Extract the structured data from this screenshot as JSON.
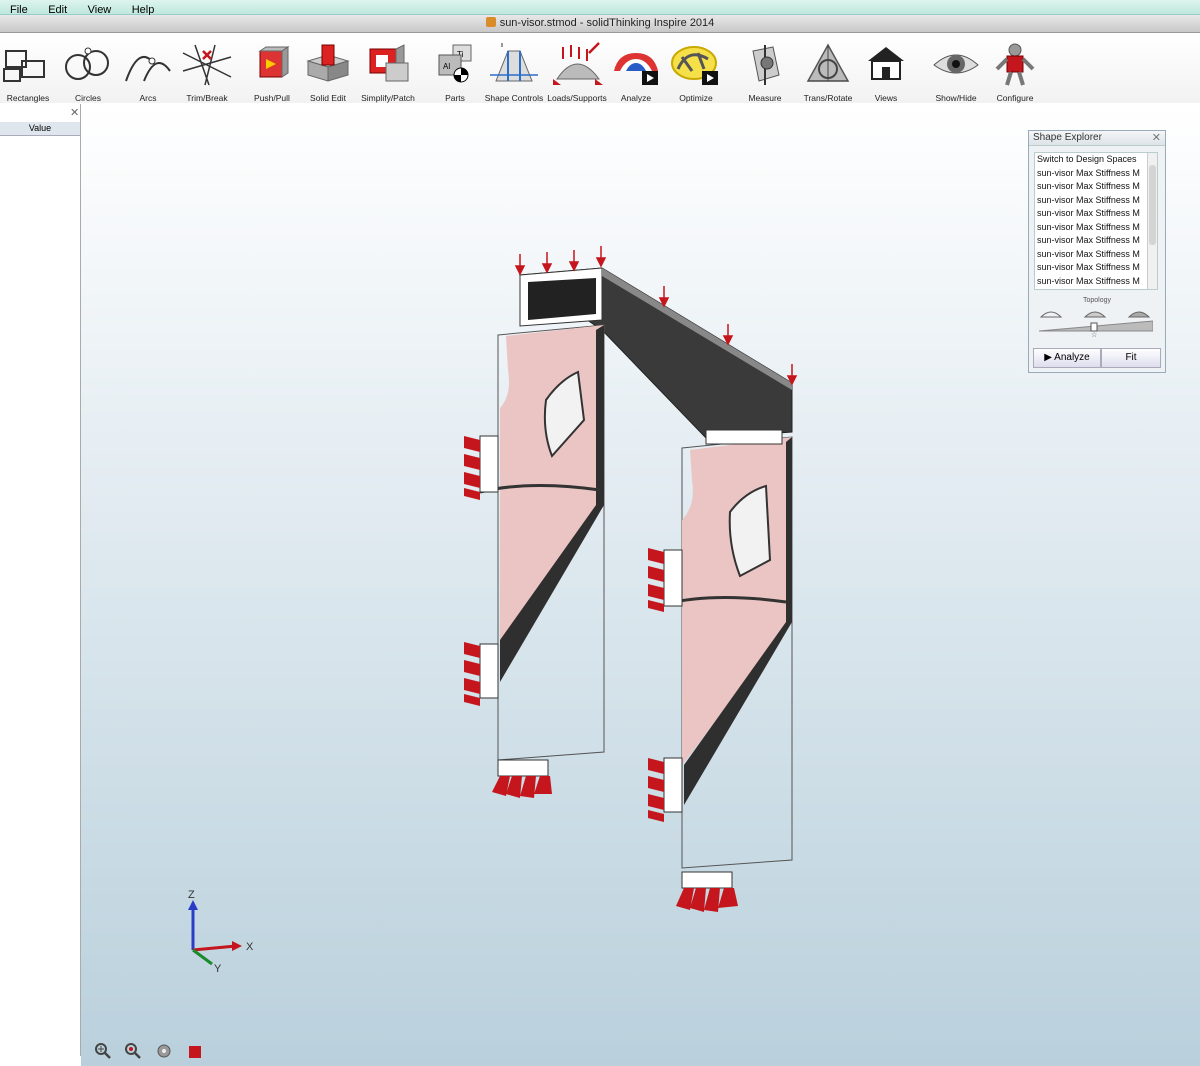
{
  "menu": [
    "File",
    "Edit",
    "View",
    "Help"
  ],
  "window_title": "sun-visor.stmod - solidThinking Inspire 2014",
  "toolbar": [
    {
      "label": "Rectangles",
      "icon": "rectangles-icon"
    },
    {
      "label": "Circles",
      "icon": "circles-icon"
    },
    {
      "label": "Arcs",
      "icon": "arcs-icon"
    },
    {
      "label": "Trim/Break",
      "icon": "trim-break-icon"
    },
    {
      "label": "Push/Pull",
      "icon": "push-pull-icon"
    },
    {
      "label": "Solid Edit",
      "icon": "solid-edit-icon"
    },
    {
      "label": "Simplify/Patch",
      "icon": "simplify-patch-icon"
    },
    {
      "label": "Parts",
      "icon": "parts-icon"
    },
    {
      "label": "Shape Controls",
      "icon": "shape-controls-icon"
    },
    {
      "label": "Loads/Supports",
      "icon": "loads-supports-icon"
    },
    {
      "label": "Analyze",
      "icon": "analyze-icon"
    },
    {
      "label": "Optimize",
      "icon": "optimize-icon"
    },
    {
      "label": "Measure",
      "icon": "measure-icon"
    },
    {
      "label": "Trans/Rotate",
      "icon": "trans-rotate-icon"
    },
    {
      "label": "Views",
      "icon": "views-icon"
    },
    {
      "label": "Show/Hide",
      "icon": "show-hide-icon"
    },
    {
      "label": "Configure",
      "icon": "configure-icon"
    }
  ],
  "property_panel": {
    "column_header": "Value"
  },
  "shape_explorer": {
    "title": "Shape Explorer",
    "items": [
      "Switch to Design Spaces",
      "sun-visor Max Stiffness M",
      "sun-visor Max Stiffness M",
      "sun-visor Max Stiffness M",
      "sun-visor Max Stiffness M",
      "sun-visor Max Stiffness M",
      "sun-visor Max Stiffness M",
      "sun-visor Max Stiffness M",
      "sun-visor Max Stiffness M",
      "sun-visor Max Stiffness M"
    ],
    "topology_label": "Topology",
    "analyze_button": "Analyze",
    "fit_button": "Fit"
  },
  "axes": {
    "z": "Z",
    "x": "X",
    "y": "Y"
  },
  "colors": {
    "load_red": "#c4161c",
    "topology_pink": "#ebc5c3",
    "beam_dark": "#3a3a3a"
  }
}
